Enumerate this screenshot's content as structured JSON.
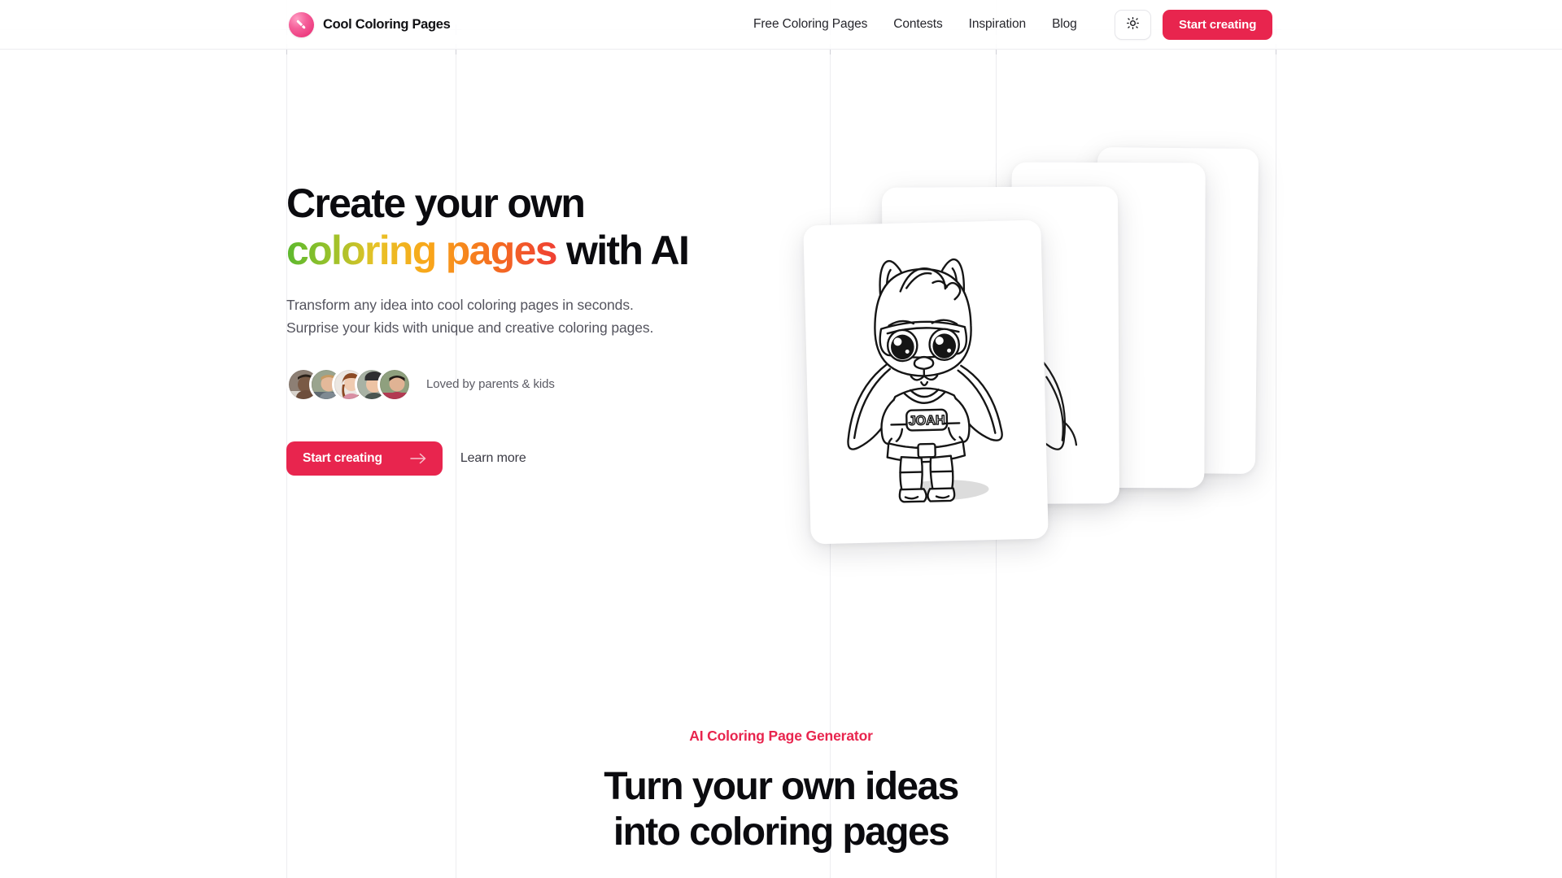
{
  "brand": {
    "name": "Cool Coloring Pages",
    "icon": "paintbrush-icon"
  },
  "header": {
    "nav": [
      {
        "label": "Free Coloring Pages"
      },
      {
        "label": "Contests"
      },
      {
        "label": "Inspiration"
      },
      {
        "label": "Blog"
      }
    ],
    "theme_toggle_icon": "sun-icon",
    "cta_label": "Start creating"
  },
  "hero": {
    "title_line1": "Create your own",
    "title_gradient": "coloring pages",
    "title_line2_tail": " with AI",
    "subtitle_line1": "Transform any idea into cool coloring pages in seconds.",
    "subtitle_line2": "Surprise your kids with unique and creative coloring pages.",
    "social_proof_text": "Loved by parents & kids",
    "avatar_count": 5,
    "primary_cta": "Start creating",
    "primary_cta_icon": "arrow-right-icon",
    "secondary_cta": "Learn more",
    "card_name_text": "JOAH"
  },
  "section": {
    "eyebrow": "AI Coloring Page Generator",
    "title_line1": "Turn your own ideas",
    "title_line2": "into coloring pages"
  },
  "colors": {
    "accent": "#e8254e",
    "brand_pink": "#e8266f",
    "gradient_start": "#5cb82e",
    "gradient_mid": "#f9a61a",
    "gradient_end": "#ef3f33",
    "text": "#0b0b0f",
    "muted": "#54545e"
  }
}
